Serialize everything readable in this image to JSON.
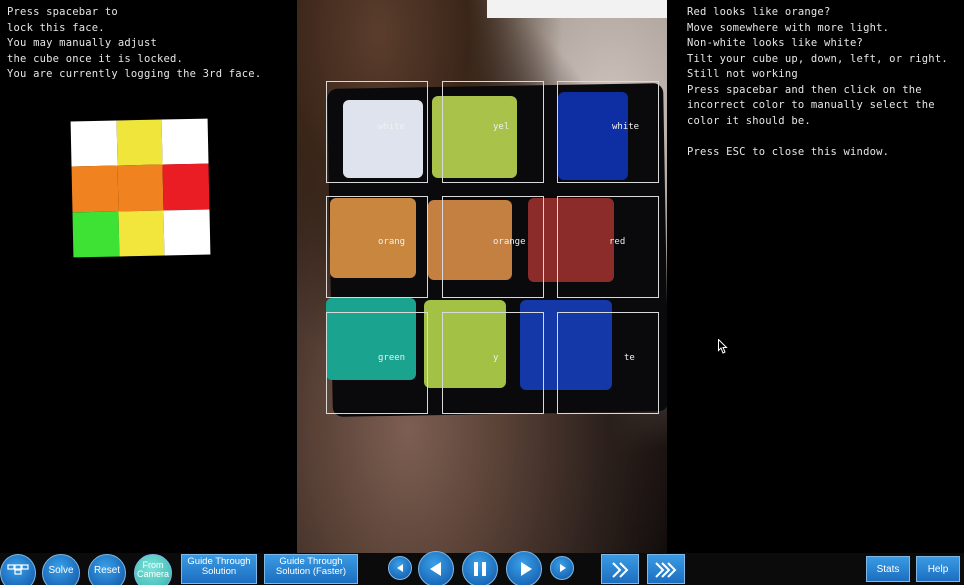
{
  "left_panel": {
    "instructions": "Press spacebar to\nlock this face.\nYou may manually adjust\nthe cube once it is locked.\nYou are currently logging the 3rd face.",
    "face_preview": [
      {
        "color": "#ffffff",
        "name": "white"
      },
      {
        "color": "#f0e53a",
        "name": "yellow"
      },
      {
        "color": "#ffffff",
        "name": "white"
      },
      {
        "color": "#f0821f",
        "name": "orange"
      },
      {
        "color": "#f0821f",
        "name": "orange"
      },
      {
        "color": "#ea1c24",
        "name": "red"
      },
      {
        "color": "#3de234",
        "name": "green"
      },
      {
        "color": "#f2e63c",
        "name": "yellow"
      },
      {
        "color": "#ffffff",
        "name": "white"
      }
    ]
  },
  "right_panel": {
    "help_text": "Red looks like orange?\nMove somewhere with more light.\nNon-white looks like white?\nTilt your cube up, down, left, or right.\nStill not working\nPress spacebar and then click on the\nincorrect color to manually select the\ncolor it should be.\n\nPress ESC to close this window."
  },
  "camera": {
    "cells": [
      {
        "label": "white",
        "sticker": "#dfe3ee"
      },
      {
        "label": "yel",
        "sticker": "#a9c24a"
      },
      {
        "label": "white",
        "sticker": "#0d2fa3"
      },
      {
        "label": "orang",
        "sticker": "#c8863f"
      },
      {
        "label": "orange",
        "sticker": "#c48040"
      },
      {
        "label": "red",
        "sticker": "#8b2b2a"
      },
      {
        "label": "green",
        "sticker": "#1aa38e"
      },
      {
        "label": "y",
        "sticker": "#a3c245"
      },
      {
        "label": "te",
        "sticker": "#1538a8"
      }
    ]
  },
  "toolbar": {
    "solve": "Solve",
    "reset": "Reset",
    "from_camera": "From Camera",
    "guide": "Guide Through Solution",
    "guide_faster": "Guide Through Solution (Faster)",
    "stats": "Stats",
    "help": "Help"
  },
  "colors": {
    "accent": "#1e6fbd",
    "accent_light": "#3aa0e8",
    "from_camera_active": "#4fc7c0"
  }
}
